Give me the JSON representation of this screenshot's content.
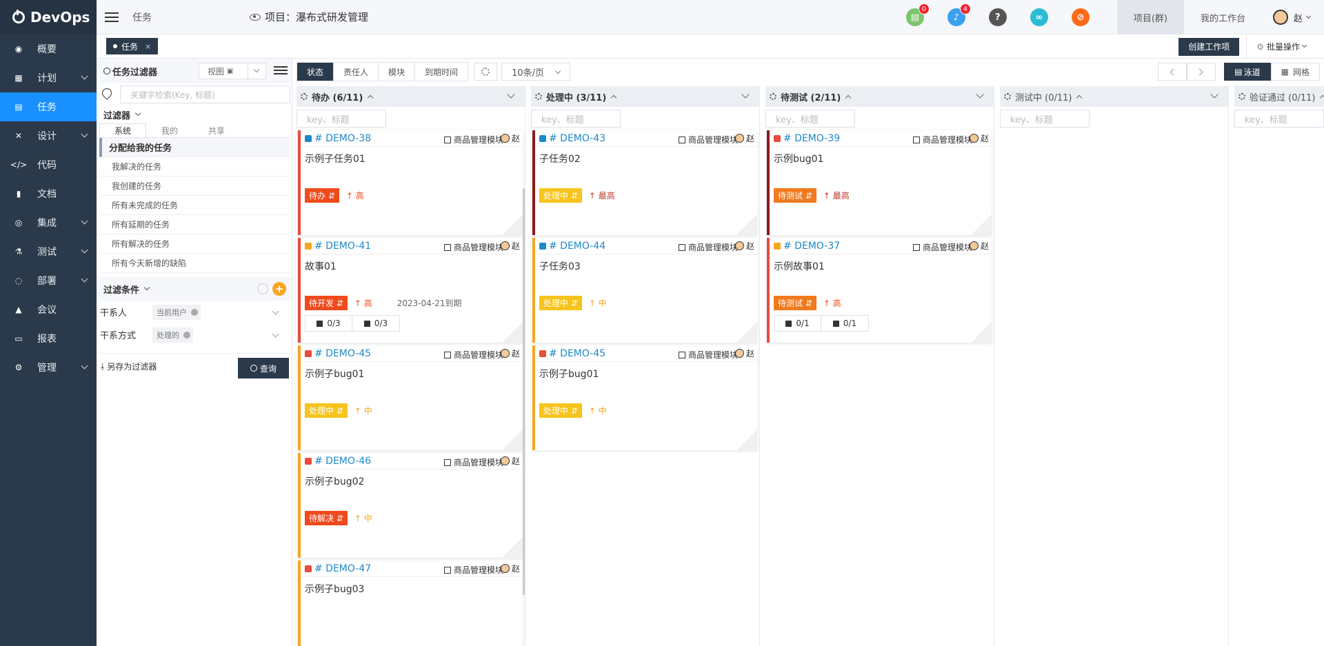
{
  "app": {
    "name": "DevOps"
  },
  "sidebar": {
    "items": [
      {
        "label": "概要",
        "icon": "dashboard-icon",
        "chevron": false
      },
      {
        "label": "计划",
        "icon": "calendar-icon",
        "chevron": true
      },
      {
        "label": "任务",
        "icon": "task-icon",
        "chevron": false,
        "active": true
      },
      {
        "label": "设计",
        "icon": "design-icon",
        "chevron": true
      },
      {
        "label": "代码",
        "icon": "code-icon",
        "chevron": false
      },
      {
        "label": "文档",
        "icon": "document-icon",
        "chevron": false
      },
      {
        "label": "集成",
        "icon": "integration-icon",
        "chevron": true
      },
      {
        "label": "测试",
        "icon": "flask-icon",
        "chevron": true
      },
      {
        "label": "部署",
        "icon": "deploy-icon",
        "chevron": true
      },
      {
        "label": "会议",
        "icon": "meeting-icon",
        "chevron": false
      },
      {
        "label": "报表",
        "icon": "report-icon",
        "chevron": false
      },
      {
        "label": "管理",
        "icon": "gear-icon",
        "chevron": true
      }
    ]
  },
  "topbar": {
    "breadcrumb": "任务",
    "project": "项目：瀑布式研发管理",
    "icons": [
      {
        "name": "clipboard-icon",
        "color": "#7cc46d",
        "badge": "0"
      },
      {
        "name": "bell-icon",
        "color": "#3aa0f0",
        "badge": "4"
      },
      {
        "name": "help-icon",
        "color": "#555555",
        "badge": ""
      },
      {
        "name": "link-icon",
        "color": "#2bbcd4",
        "badge": ""
      },
      {
        "name": "compass-icon",
        "color": "#ff6a1a",
        "badge": ""
      }
    ],
    "tabs": [
      "项目(群)",
      "我的工作台"
    ],
    "user": "赵"
  },
  "tagbar": {
    "tab": "任务",
    "close": "×",
    "create_button": "创建工作项",
    "batch": "批量操作"
  },
  "filter": {
    "title": "任务过滤器",
    "view_label": "视图",
    "search_placeholder": "关键字检索(Key, 标题)",
    "filters_label": "过滤器",
    "tabs": [
      "系统",
      "我的",
      "共享"
    ],
    "items": [
      "分配给我的任务",
      "我解决的任务",
      "我创建的任务",
      "所有未完成的任务",
      "所有延期的任务",
      "所有解决的任务",
      "所有今天新增的缺陷"
    ],
    "conditions_label": "过滤条件",
    "conditions": [
      {
        "label": "干系人",
        "value": "当前用户"
      },
      {
        "label": "干系方式",
        "value": "处理的"
      }
    ],
    "save_label": "另存为过滤器",
    "query_button": "查询"
  },
  "board": {
    "group_tabs": [
      "状态",
      "责任人",
      "模块",
      "到期时间"
    ],
    "page_size": "10条/页",
    "view_swimlane": "泳道",
    "view_grid": "网格",
    "columns": [
      {
        "title": "待办 (6/11)",
        "search_placeholder": "key、标题",
        "cards": [
          {
            "key": "# DEMO-38",
            "type_color": "#1e88c8",
            "module": "商品管理模块",
            "owner": "赵",
            "title": "示例子任务01",
            "status": "待办",
            "status_color": "#f04a1d",
            "priority": "高",
            "priority_color": "#f04a1d",
            "border": "#e74c3c",
            "date": "",
            "counts": null
          },
          {
            "key": "# DEMO-41",
            "type_color": "#f5a623",
            "module": "商品管理模块",
            "owner": "赵",
            "title": "故事01",
            "status": "待开发",
            "status_color": "#f04a1d",
            "priority": "高",
            "priority_color": "#f04a1d",
            "border": "#e74c3c",
            "date": "2023-04-21到期",
            "counts": [
              "0/3",
              "0/3"
            ]
          },
          {
            "key": "# DEMO-45",
            "type_color": "#e74c3c",
            "module": "商品管理模块",
            "owner": "赵",
            "title": "示例子bug01",
            "status": "处理中",
            "status_color": "#f7c41d",
            "priority": "中",
            "priority_color": "#f5a623",
            "border": "#f5a623",
            "date": "",
            "counts": null
          },
          {
            "key": "# DEMO-46",
            "type_color": "#e74c3c",
            "module": "商品管理模块",
            "owner": "赵",
            "title": "示例子bug02",
            "status": "待解决",
            "status_color": "#f04a1d",
            "priority": "中",
            "priority_color": "#f5a623",
            "border": "#f5a623",
            "date": "",
            "counts": null
          },
          {
            "key": "# DEMO-47",
            "type_color": "#e74c3c",
            "module": "商品管理模块",
            "owner": "赵",
            "title": "示例子bug03",
            "status": "",
            "status_color": "",
            "priority": "",
            "priority_color": "",
            "border": "#f5a623",
            "date": "",
            "counts": null
          }
        ]
      },
      {
        "title": "处理中 (3/11)",
        "search_placeholder": "key、标题",
        "cards": [
          {
            "key": "# DEMO-43",
            "type_color": "#1e88c8",
            "module": "商品管理模块",
            "owner": "赵",
            "title": "子任务02",
            "status": "处理中",
            "status_color": "#f7c41d",
            "priority": "最高",
            "priority_color": "#c0392b",
            "border": "#8b1a1a",
            "date": "",
            "counts": null
          },
          {
            "key": "# DEMO-44",
            "type_color": "#1e88c8",
            "module": "商品管理模块",
            "owner": "赵",
            "title": "子任务03",
            "status": "处理中",
            "status_color": "#f7c41d",
            "priority": "中",
            "priority_color": "#f5a623",
            "border": "#f5a623",
            "date": "",
            "counts": null
          },
          {
            "key": "# DEMO-45",
            "type_color": "#e74c3c",
            "module": "商品管理模块",
            "owner": "赵",
            "title": "示例子bug01",
            "status": "处理中",
            "status_color": "#f7c41d",
            "priority": "中",
            "priority_color": "#f5a623",
            "border": "#f5a623",
            "date": "",
            "counts": null
          }
        ]
      },
      {
        "title": "待测试 (2/11)",
        "search_placeholder": "key、标题",
        "cards": [
          {
            "key": "# DEMO-39",
            "type_color": "#e74c3c",
            "module": "商品管理模块",
            "owner": "赵",
            "title": "示例bug01",
            "status": "待测试",
            "status_color": "#f07a1d",
            "priority": "最高",
            "priority_color": "#c0392b",
            "border": "#8b1a1a",
            "date": "",
            "counts": null
          },
          {
            "key": "# DEMO-37",
            "type_color": "#f5a623",
            "module": "商品管理模块",
            "owner": "赵",
            "title": "示例故事01",
            "status": "待测试",
            "status_color": "#f07a1d",
            "priority": "高",
            "priority_color": "#f04a1d",
            "border": "#e74c3c",
            "date": "",
            "counts": [
              "0/1",
              "0/1"
            ]
          }
        ]
      },
      {
        "title": "测试中 (0/11)",
        "search_placeholder": "key、标题",
        "cards": []
      },
      {
        "title": "验证通过 (0/11)",
        "search_placeholder": "key、标题",
        "cards": []
      }
    ]
  }
}
